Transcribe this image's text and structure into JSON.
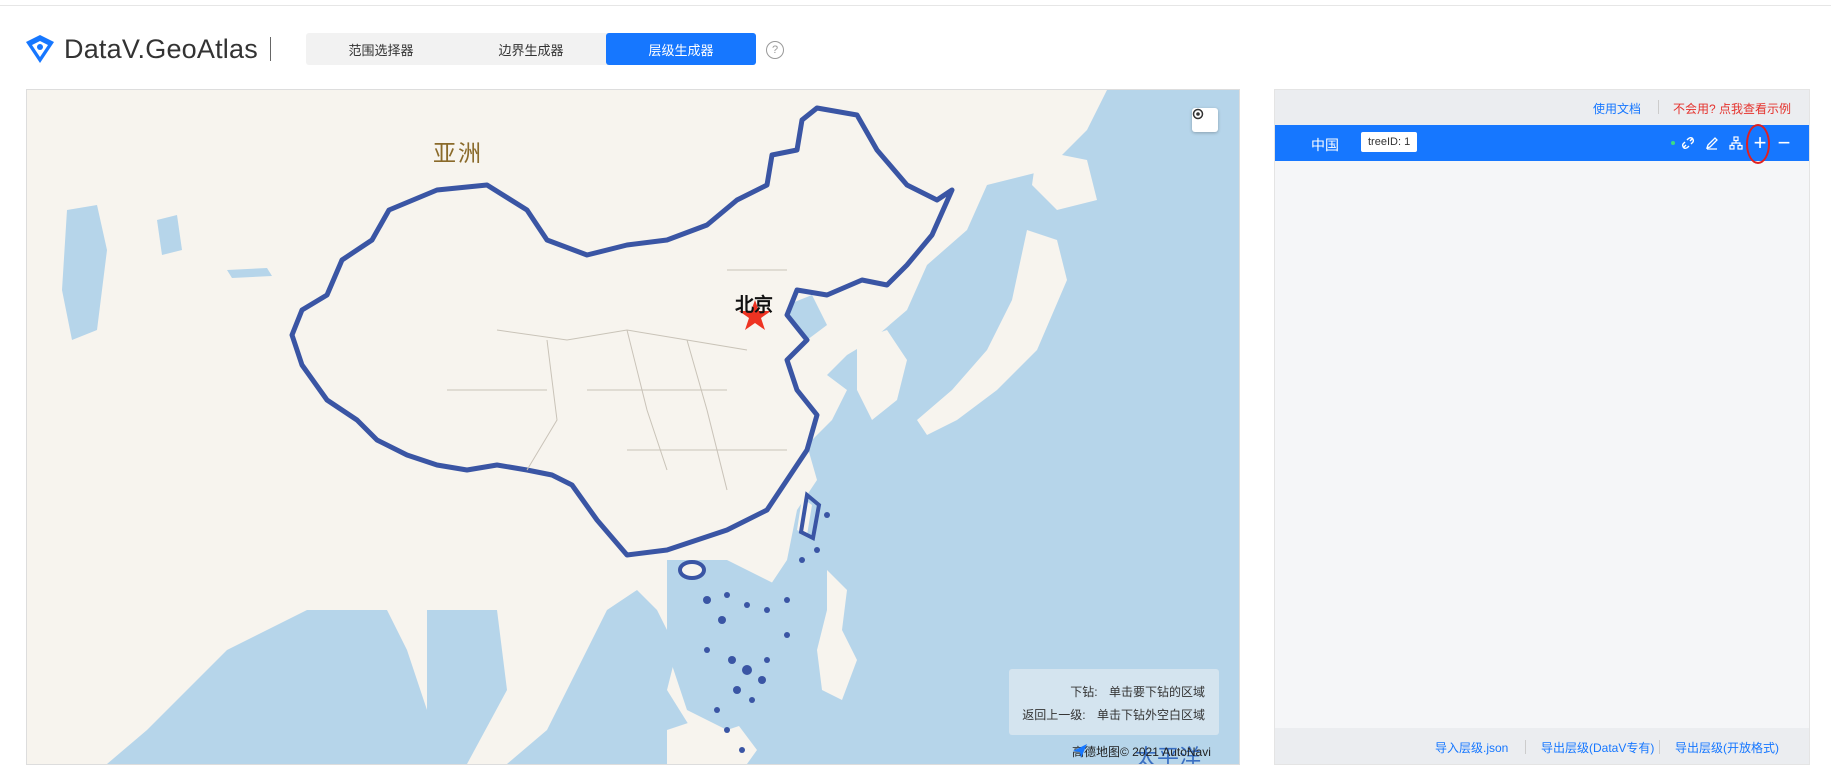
{
  "header": {
    "brand": "DataV.GeoAtlas",
    "tabs": [
      {
        "label": "范围选择器",
        "active": false
      },
      {
        "label": "边界生成器",
        "active": false
      },
      {
        "label": "层级生成器",
        "active": true
      }
    ],
    "help_glyph": "?"
  },
  "map": {
    "labels": {
      "continent": "亚洲",
      "capital": "北京",
      "ocean": "太平洋"
    },
    "hints": [
      {
        "key": "下钻:",
        "value": "单击要下钻的区域"
      },
      {
        "key": "返回上一级:",
        "value": "单击下钻外空白区域"
      }
    ],
    "attribution": "高德地图© 2021 AutoNavi",
    "colors": {
      "water": "#b6d5ea",
      "land": "#f7f4ee",
      "boundary": "#3a55a4",
      "capital_star": "#ee3322"
    },
    "icons": {
      "locate": "locate-icon",
      "amap": "amap-logo-icon"
    }
  },
  "panel": {
    "links": {
      "docs": "使用文档",
      "example": "不会用? 点我查看示例"
    },
    "tree": {
      "name": "中国",
      "tree_id": "treeID: 1",
      "plus_glyph": "+",
      "minus_glyph": "−",
      "icons": [
        "unlink-icon",
        "edit-icon",
        "hierarchy-icon",
        "add-icon",
        "remove-icon"
      ]
    },
    "footer": {
      "import": "导入层级.json",
      "export_datav": "导出层级(DataV专有)",
      "export_open": "导出层级(开放格式)"
    },
    "colors": {
      "accent": "#1677ff",
      "danger": "#e5322d"
    }
  }
}
